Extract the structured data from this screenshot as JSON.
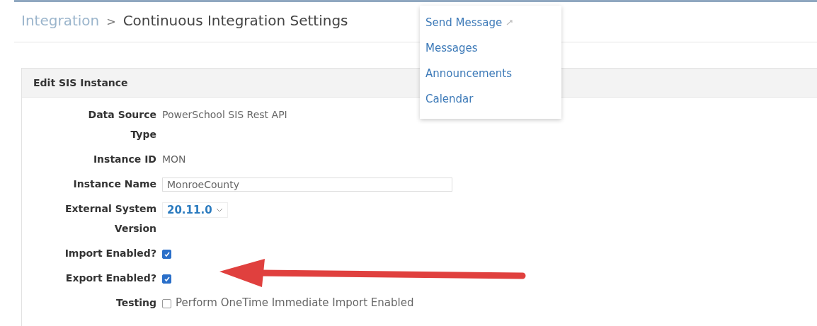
{
  "breadcrumb": {
    "parent": "Integration",
    "separator": ">",
    "current": "Continuous Integration Settings"
  },
  "menu": {
    "items": [
      {
        "label": "Send Message",
        "external": true
      },
      {
        "label": "Messages",
        "external": false
      },
      {
        "label": "Announcements",
        "external": false
      },
      {
        "label": "Calendar",
        "external": false
      }
    ]
  },
  "panel": {
    "title": "Edit SIS Instance",
    "fields": [
      {
        "kind": "text",
        "label": "Data Source Type",
        "value": "PowerSchool SIS Rest API"
      },
      {
        "kind": "text",
        "label": "Instance ID",
        "value": "MON"
      },
      {
        "kind": "input",
        "label": "Instance Name",
        "value": "MonroeCounty"
      },
      {
        "kind": "select",
        "label": "External System Version",
        "value": "20.11.0"
      },
      {
        "kind": "checkbox",
        "label": "Import Enabled?",
        "checked": true
      },
      {
        "kind": "checkbox",
        "label": "Export Enabled?",
        "checked": true
      },
      {
        "kind": "checkbox",
        "label": "Testing",
        "checked": false,
        "text": "Perform OneTime Immediate Import Enabled"
      }
    ]
  }
}
